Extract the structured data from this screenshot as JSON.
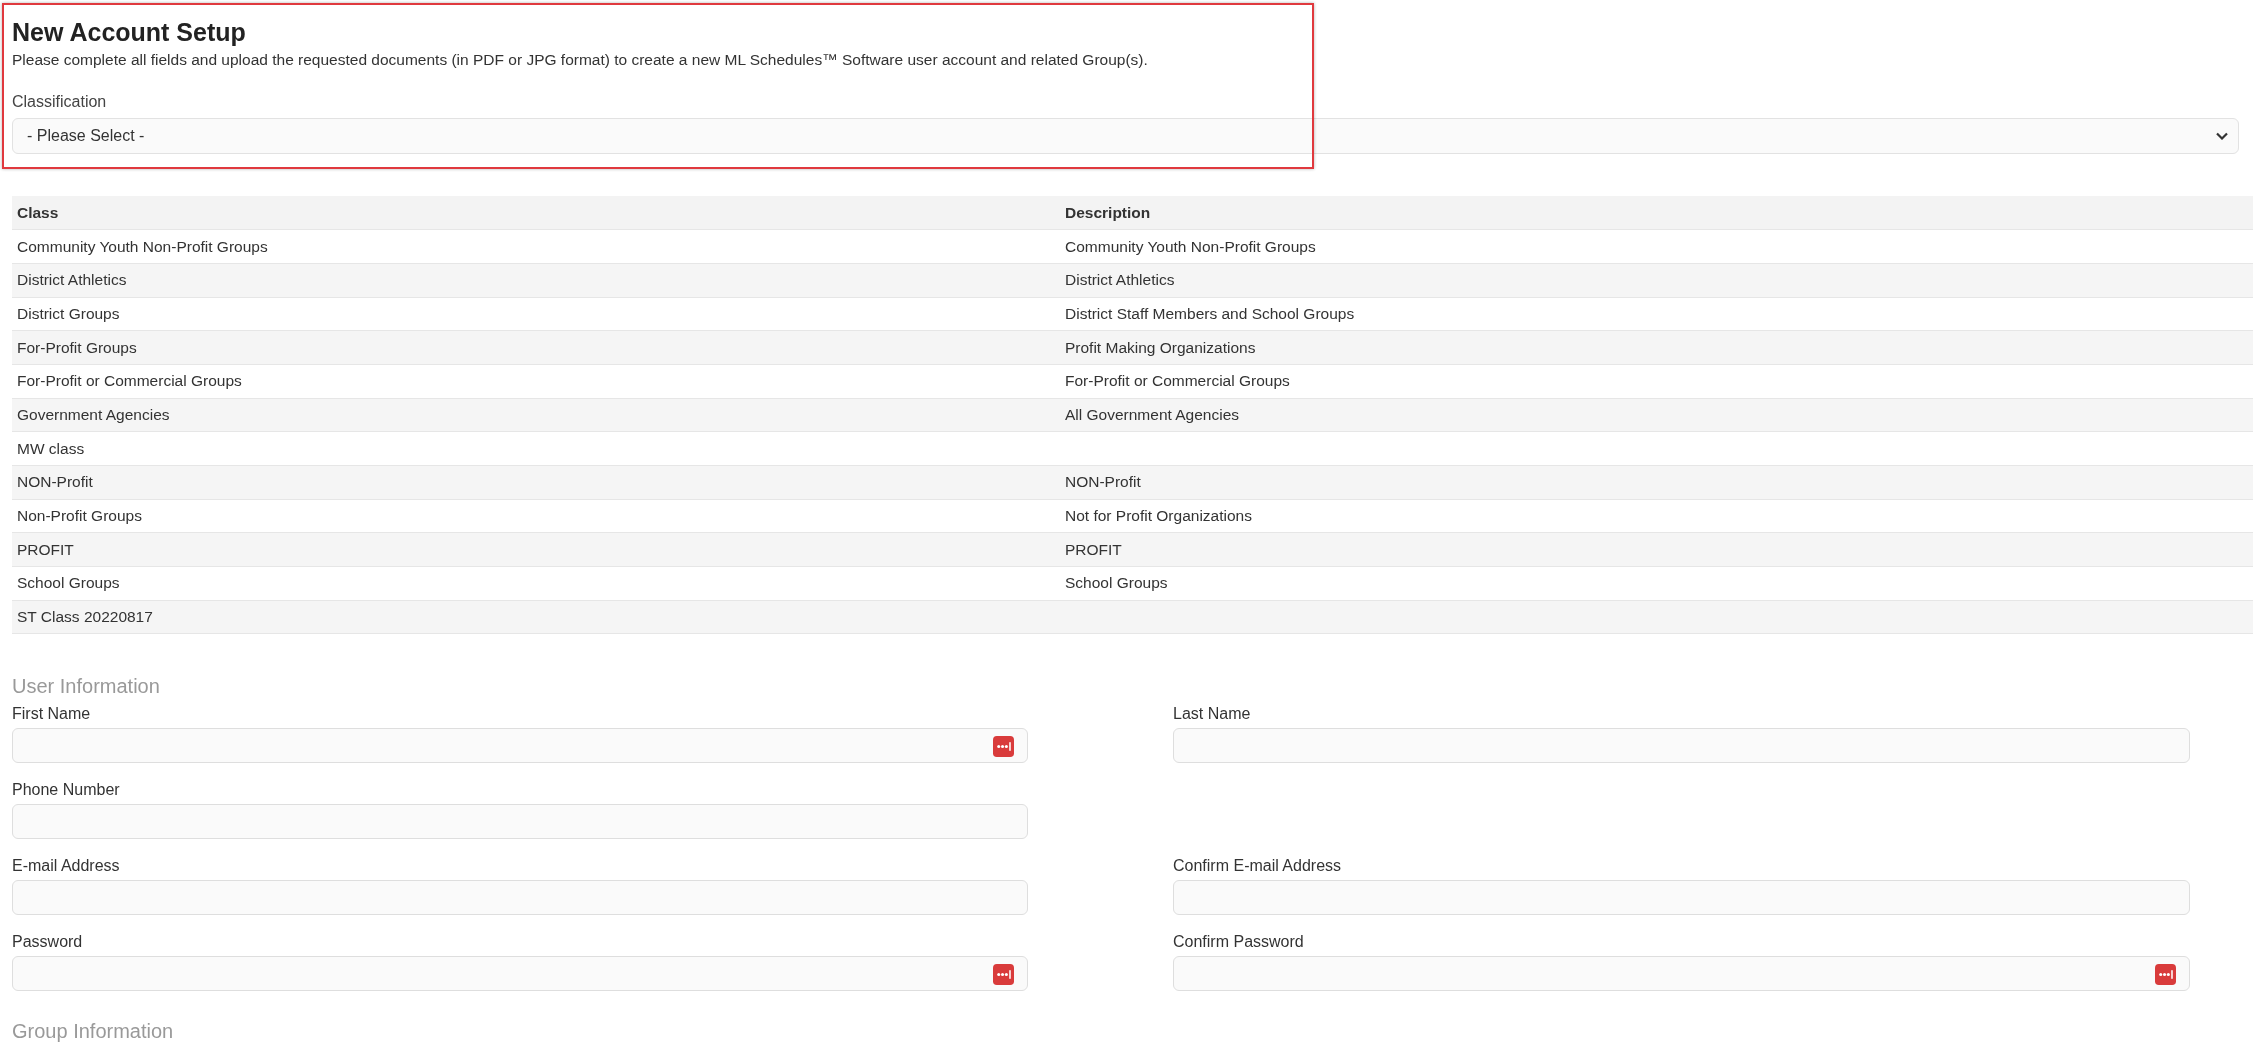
{
  "header": {
    "title": "New Account Setup",
    "description": "Please complete all fields and upload the requested documents (in PDF or JPG format) to create a new ML Schedules™ Software user account and related Group(s).",
    "highlighted": true
  },
  "classification": {
    "label": "Classification",
    "value": "- Please Select -"
  },
  "table": {
    "columns": [
      "Class",
      "Description"
    ],
    "rows": [
      [
        "Community Youth Non-Profit Groups",
        "Community Youth Non-Profit Groups"
      ],
      [
        "District Athletics",
        "District Athletics"
      ],
      [
        "District Groups",
        "District Staff Members and School Groups"
      ],
      [
        "For-Profit Groups",
        "Profit Making Organizations"
      ],
      [
        "For-Profit or Commercial Groups",
        "For-Profit or Commercial Groups"
      ],
      [
        "Government Agencies",
        "All Government Agencies"
      ],
      [
        "MW class",
        ""
      ],
      [
        "NON-Profit",
        "NON-Profit"
      ],
      [
        "Non-Profit Groups",
        "Not for Profit Organizations"
      ],
      [
        "PROFIT",
        "PROFIT"
      ],
      [
        "School Groups",
        "School Groups"
      ],
      [
        "ST Class 20220817",
        ""
      ]
    ]
  },
  "user_information": {
    "heading": "User Information",
    "rows": [
      [
        {
          "label": "First Name",
          "password_manager_icon": true
        },
        {
          "label": "Last Name",
          "password_manager_icon": false
        }
      ],
      [
        {
          "label": "Phone Number",
          "password_manager_icon": false
        }
      ],
      [
        {
          "label": "E-mail Address",
          "password_manager_icon": false
        },
        {
          "label": "Confirm E-mail Address",
          "password_manager_icon": false
        }
      ],
      [
        {
          "label": "Password",
          "password_manager_icon": true
        },
        {
          "label": "Confirm Password",
          "password_manager_icon": true
        }
      ]
    ]
  },
  "group_information": {
    "heading": "Group Information"
  }
}
